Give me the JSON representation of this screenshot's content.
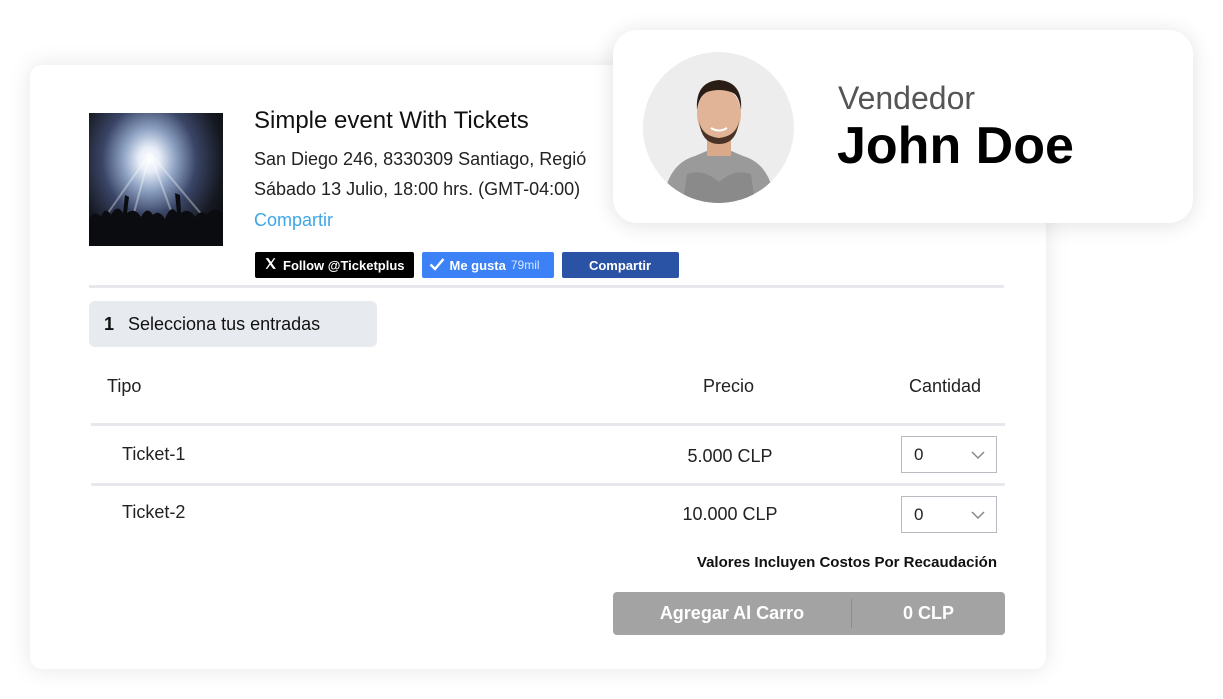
{
  "event": {
    "title": "Simple event With Tickets",
    "address": "San Diego 246, 8330309 Santiago, Regió",
    "date": "Sábado 13 Julio, 18:00 hrs. (GMT-04:00)",
    "share_link": "Compartir"
  },
  "social": {
    "follow_label": "Follow @Ticketplus",
    "like_label": "Me gusta",
    "like_count": "79mil",
    "share_label": "Compartir"
  },
  "step": {
    "number": "1",
    "label": "Selecciona tus entradas"
  },
  "table": {
    "headers": {
      "type": "Tipo",
      "price": "Precio",
      "quantity": "Cantidad"
    },
    "rows": [
      {
        "name": "Ticket-1",
        "price": "5.000 CLP",
        "quantity": "0"
      },
      {
        "name": "Ticket-2",
        "price": "10.000 CLP",
        "quantity": "0"
      }
    ]
  },
  "note": "Valores Incluyen Costos Por Recaudación",
  "cart": {
    "button_label": "Agregar Al Carro",
    "total": "0 CLP"
  },
  "seller": {
    "role": "Vendedor",
    "name": "John Doe"
  },
  "colors": {
    "link": "#3ea6e6",
    "like_button": "#3c82f6",
    "share_button": "#2a53a6",
    "cart_button": "#a3a3a3"
  }
}
